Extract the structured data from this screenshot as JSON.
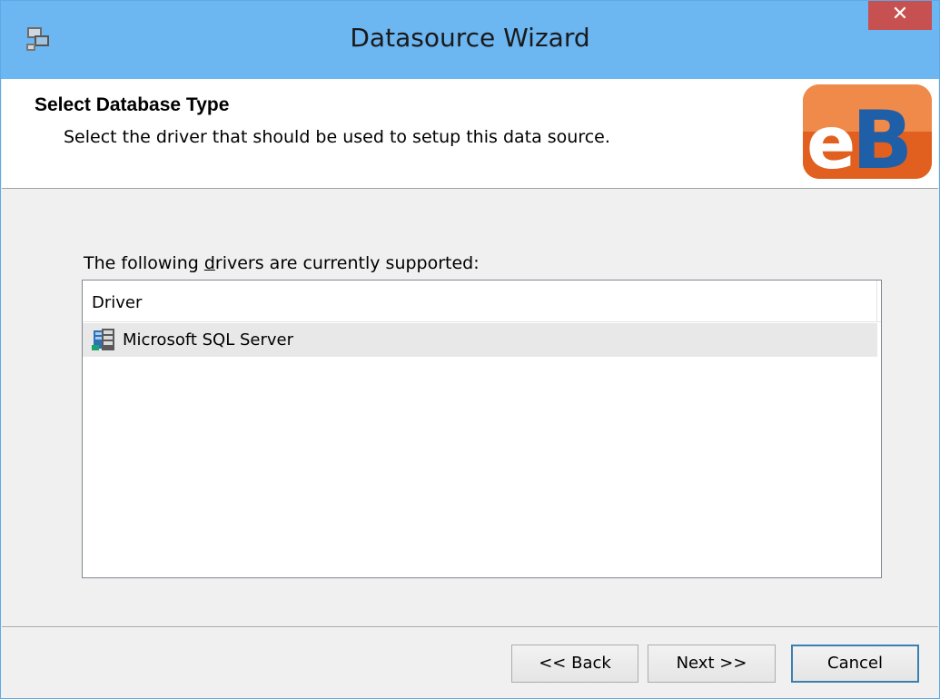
{
  "window": {
    "title": "Datasource Wizard",
    "close_label": "✕"
  },
  "header": {
    "title": "Select Database Type",
    "subtitle": "Select the driver that should be used to setup this data source.",
    "logo_text": "eB"
  },
  "content": {
    "list_label_pre": "The following ",
    "list_label_accel": "d",
    "list_label_post": "rivers are currently supported:",
    "columns": [
      "Driver"
    ],
    "rows": [
      {
        "label": "Microsoft SQL Server",
        "icon": "database-server-icon",
        "selected": true
      }
    ]
  },
  "buttons": {
    "back": "<< Back",
    "next": "Next >>",
    "cancel": "Cancel"
  },
  "colors": {
    "titlebar": "#6cb6f2",
    "close": "#c75050",
    "logo_orange": "#ee6b2c",
    "logo_blue": "#1f5fa8",
    "default_button_border": "#3c7fb1"
  }
}
